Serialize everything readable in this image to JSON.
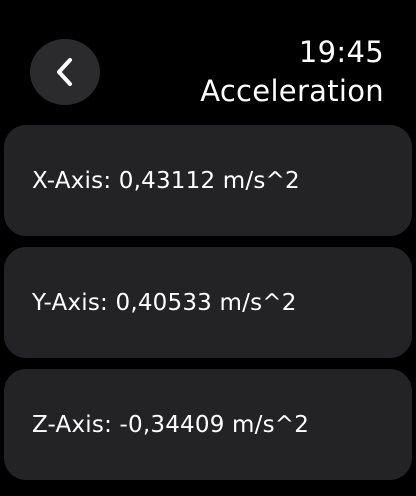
{
  "header": {
    "time": "19:45",
    "title": "Acceleration",
    "back_icon": "chevron-left-icon"
  },
  "readings": [
    {
      "axis": "X",
      "label": "X-Axis: 0,43112 m/s^2"
    },
    {
      "axis": "Y",
      "label": "Y-Axis: 0,40533 m/s^2"
    },
    {
      "axis": "Z",
      "label": "Z-Axis: -0,34409 m/s^2"
    }
  ],
  "colors": {
    "background": "#000000",
    "card": "#232325",
    "button": "#2b2b2d",
    "text": "#ffffff"
  }
}
